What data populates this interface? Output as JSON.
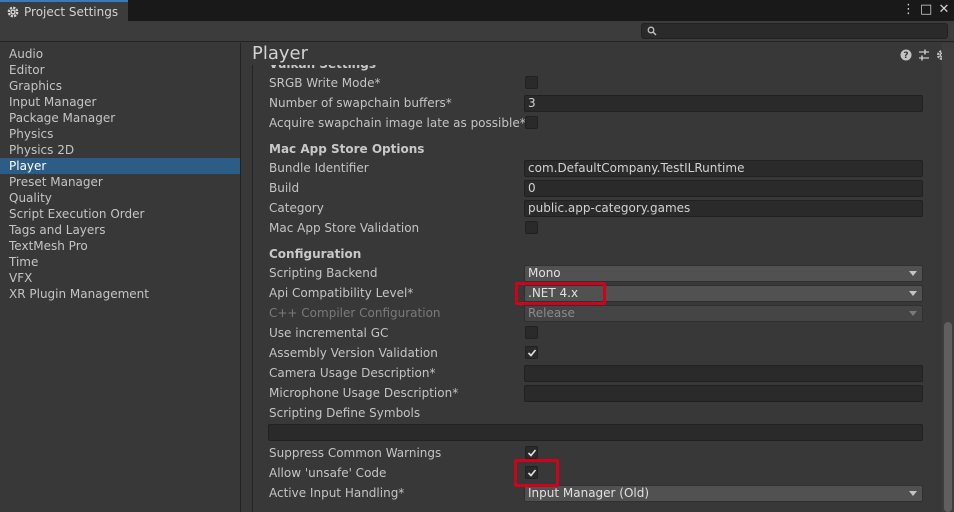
{
  "window": {
    "title": "Project Settings",
    "controls": [
      "⋮",
      "□",
      "✕"
    ]
  },
  "search": {
    "placeholder": ""
  },
  "sidebar": {
    "items": [
      {
        "label": "Audio",
        "selected": false
      },
      {
        "label": "Editor",
        "selected": false
      },
      {
        "label": "Graphics",
        "selected": false
      },
      {
        "label": "Input Manager",
        "selected": false
      },
      {
        "label": "Package Manager",
        "selected": false
      },
      {
        "label": "Physics",
        "selected": false
      },
      {
        "label": "Physics 2D",
        "selected": false
      },
      {
        "label": "Player",
        "selected": true
      },
      {
        "label": "Preset Manager",
        "selected": false
      },
      {
        "label": "Quality",
        "selected": false
      },
      {
        "label": "Script Execution Order",
        "selected": false
      },
      {
        "label": "Tags and Layers",
        "selected": false
      },
      {
        "label": "TextMesh Pro",
        "selected": false
      },
      {
        "label": "Time",
        "selected": false
      },
      {
        "label": "VFX",
        "selected": false
      },
      {
        "label": "XR Plugin Management",
        "selected": false
      }
    ]
  },
  "main": {
    "title": "Player",
    "vulkan": {
      "heading": "Vulkan Settings",
      "srgb_write_label": "SRGB Write Mode*",
      "srgb_write_checked": false,
      "swapchain_buffers_label": "Number of swapchain buffers*",
      "swapchain_buffers_value": "3",
      "acquire_late_label": "Acquire swapchain image late as possible*",
      "acquire_late_checked": false
    },
    "mac": {
      "heading": "Mac App Store Options",
      "bundle_label": "Bundle Identifier",
      "bundle_value": "com.DefaultCompany.TestILRuntime",
      "build_label": "Build",
      "build_value": "0",
      "category_label": "Category",
      "category_value": "public.app-category.games",
      "validation_label": "Mac App Store Validation",
      "validation_checked": false
    },
    "config": {
      "heading": "Configuration",
      "backend_label": "Scripting Backend",
      "backend_value": "Mono",
      "api_label": "Api Compatibility Level*",
      "api_value": ".NET 4.x",
      "cpp_label": "C++ Compiler Configuration",
      "cpp_value": "Release",
      "incgc_label": "Use incremental GC",
      "incgc_checked": false,
      "asmver_label": "Assembly Version Validation",
      "asmver_checked": true,
      "camera_label": "Camera Usage Description*",
      "camera_value": "",
      "mic_label": "Microphone Usage Description*",
      "mic_value": "",
      "define_label": "Scripting Define Symbols",
      "define_value": "",
      "suppress_label": "Suppress Common Warnings",
      "suppress_checked": true,
      "unsafe_label": "Allow 'unsafe' Code",
      "unsafe_checked": true,
      "input_label": "Active Input Handling*",
      "input_value": "Input Manager (Old)"
    }
  },
  "colors": {
    "highlight": "#d0021b",
    "selection": "#2c5d87",
    "tab_accent": "#3a79bb"
  }
}
